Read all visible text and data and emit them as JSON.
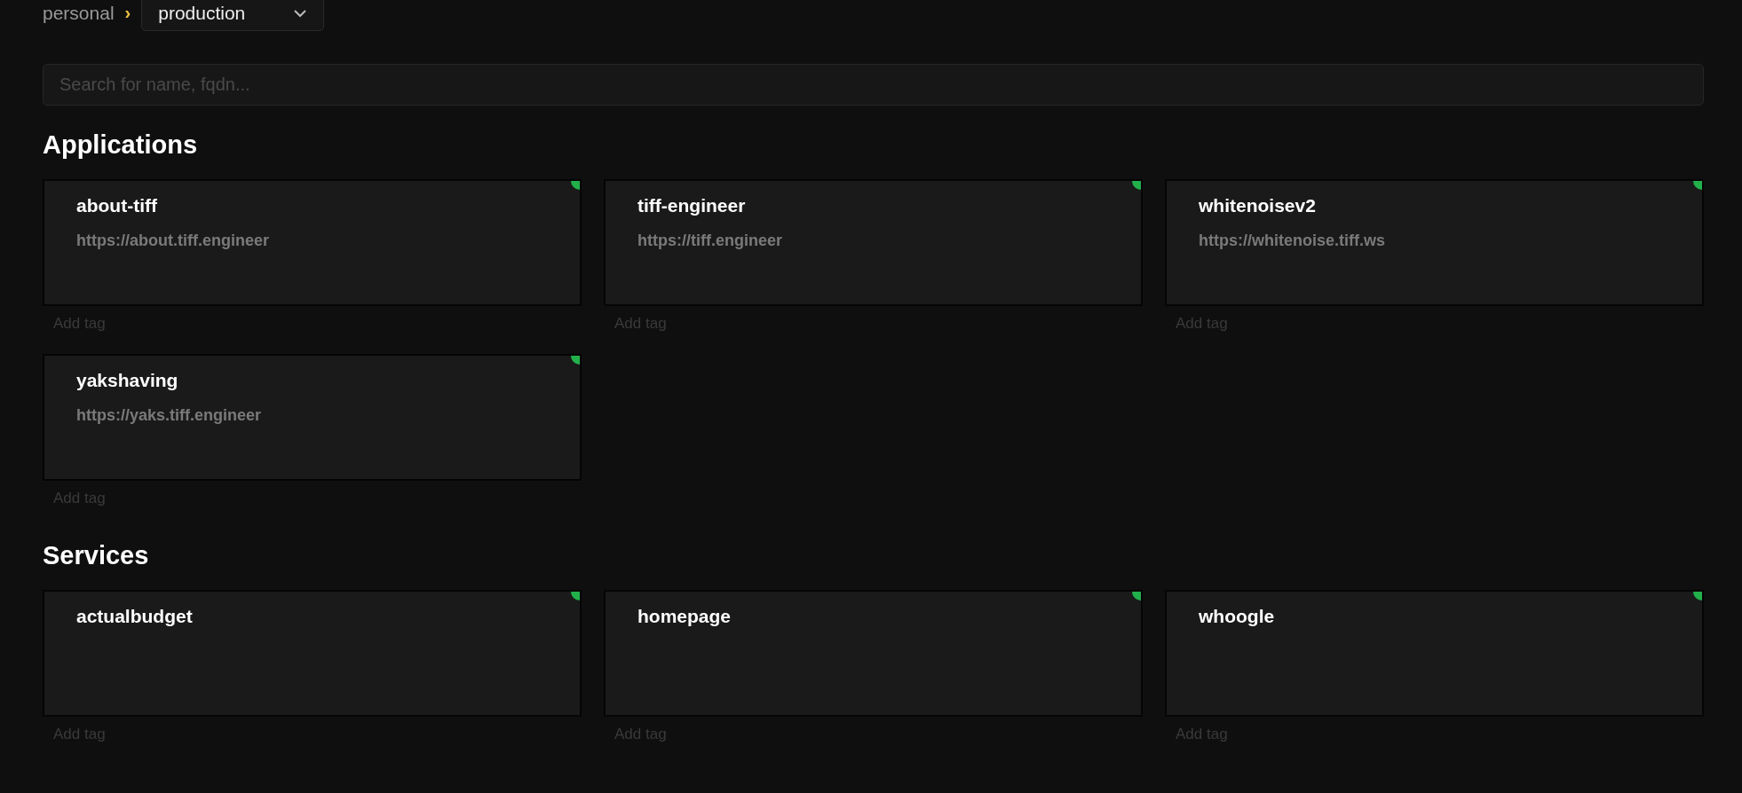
{
  "breadcrumb": {
    "parent": "personal",
    "separator": "›",
    "dropdown": {
      "value": "production"
    }
  },
  "search": {
    "placeholder": "Search for name, fqdn..."
  },
  "sections": [
    {
      "title": "Applications",
      "cards": [
        {
          "name": "about-tiff",
          "url": "https://about.tiff.engineer",
          "online": true,
          "tag_placeholder": "Add tag"
        },
        {
          "name": "tiff-engineer",
          "url": "https://tiff.engineer",
          "online": true,
          "tag_placeholder": "Add tag"
        },
        {
          "name": "whitenoisev2",
          "url": "https://whitenoise.tiff.ws",
          "online": true,
          "tag_placeholder": "Add tag"
        },
        {
          "name": "yakshaving",
          "url": "https://yaks.tiff.engineer",
          "online": true,
          "tag_placeholder": "Add tag"
        }
      ]
    },
    {
      "title": "Services",
      "cards": [
        {
          "name": "actualbudget",
          "online": true,
          "tag_placeholder": "Add tag"
        },
        {
          "name": "homepage",
          "online": true,
          "tag_placeholder": "Add tag"
        },
        {
          "name": "whoogle",
          "online": true,
          "tag_placeholder": "Add tag"
        }
      ]
    }
  ]
}
